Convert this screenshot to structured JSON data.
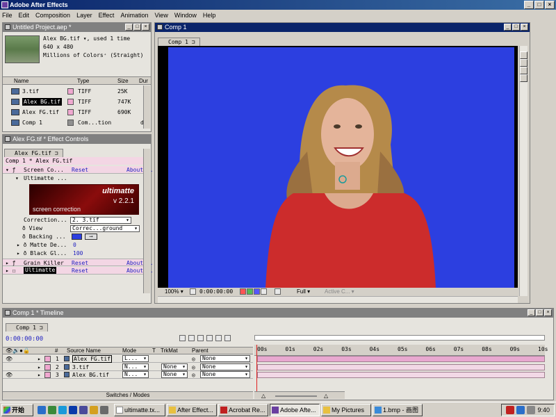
{
  "app": {
    "title": "Adobe After Effects"
  },
  "menu": [
    "File",
    "Edit",
    "Composition",
    "Layer",
    "Effect",
    "Animation",
    "View",
    "Window",
    "Help"
  ],
  "project": {
    "title": "Untitled Project.aep *",
    "thumb_info": [
      "Alex BG.tif ▾, used 1 time",
      "640 x 480",
      "Millions of Colors⁺ (Straight)"
    ],
    "columns": [
      "Name",
      "Type",
      "Size",
      "Dur"
    ],
    "items": [
      {
        "name": "3.tif",
        "type": "TIFF",
        "size": "25K",
        "color": "#f0a8d0"
      },
      {
        "name": "Alex BG.tif",
        "type": "TIFF",
        "size": "747K",
        "color": "#f0a8d0",
        "selected": true
      },
      {
        "name": "Alex FG.tif",
        "type": "TIFF",
        "size": "690K",
        "color": "#f0a8d0"
      },
      {
        "name": "Comp 1",
        "type": "Com...tion",
        "size": "",
        "extra": "d",
        "color": "#909090"
      }
    ]
  },
  "effects": {
    "title": "Alex FG.tif * Effect Controls",
    "tab": "Alex FG.tif",
    "breadcrumb": "Comp 1 * Alex FG.tif",
    "screen_correction": {
      "name": "Screen Co...",
      "reset": "Reset",
      "about": "About..."
    },
    "ultimatte_group": "Ultimatte ...",
    "logo": {
      "brand": "ultimatte",
      "version": "v 2.2.1",
      "caption": "screen correction"
    },
    "props": [
      {
        "label": "Correction...",
        "value": "2. 3.tif"
      },
      {
        "label": "View",
        "value": "Correc...ground"
      },
      {
        "label": "Backing ...",
        "value": ""
      },
      {
        "label": "Matte De...",
        "value": "0"
      },
      {
        "label": "Black Gl...",
        "value": "100"
      }
    ],
    "grain_killer": {
      "name": "Grain Killer",
      "reset": "Reset",
      "about": "About..."
    },
    "ultimatte": {
      "name": "Ultimatte",
      "reset": "Reset",
      "about": "About..."
    }
  },
  "comp": {
    "title": "Comp 1",
    "tab": "Comp 1",
    "zoom": "100%",
    "timecode": "0:00:00:00",
    "resolution": "Full",
    "camera": "Active C...",
    "bg_color": "#2c3fe0"
  },
  "timeline": {
    "title": "Comp 1 * Timeline",
    "tab": "Comp 1",
    "timecode": "0:00:00:00",
    "columns": [
      "#",
      "Source Name",
      "Mode",
      "T",
      "TrkMat",
      "Parent"
    ],
    "ruler": [
      "00s",
      "01s",
      "02s",
      "03s",
      "04s",
      "05s",
      "06s",
      "07s",
      "08s",
      "09s",
      "10s"
    ],
    "layers": [
      {
        "num": "1",
        "name": "Alex FG.tif",
        "mode": "L...",
        "trkmat": "",
        "parent": "None"
      },
      {
        "num": "2",
        "name": "3.tif",
        "mode": "N...",
        "trkmat": "None",
        "parent": "None"
      },
      {
        "num": "3",
        "name": "Alex BG.tif",
        "mode": "N...",
        "trkmat": "None",
        "parent": "None"
      }
    ],
    "footer": "Switches / Modes"
  },
  "taskbar": {
    "start": "开始",
    "items": [
      "ultimatte.tx...",
      "After Effect...",
      "Acrobat Re...",
      "Adobe Afte...",
      "My Pictures",
      "1.bmp - 画图"
    ],
    "clock": "9:40"
  }
}
